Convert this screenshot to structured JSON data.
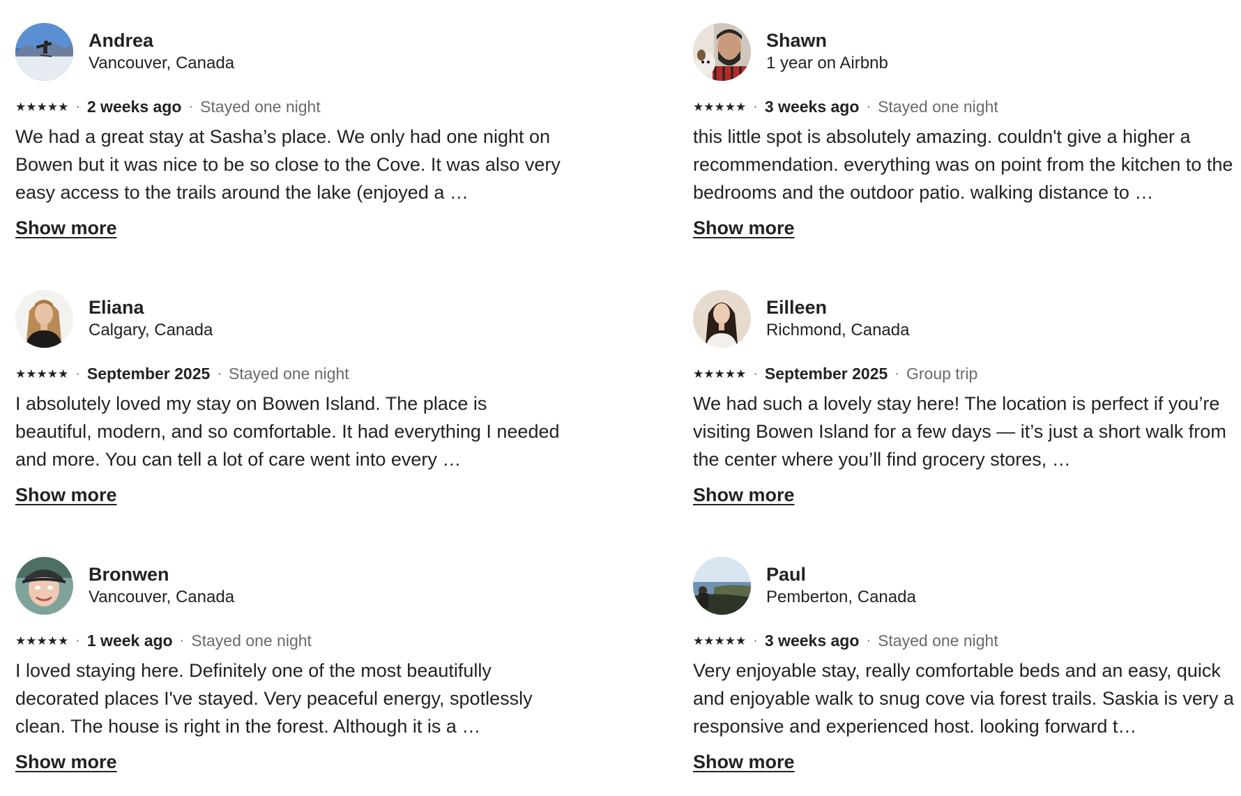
{
  "reviews": [
    {
      "name": "Andrea",
      "sub": "Vancouver, Canada",
      "rating_stars": 5,
      "stars": "★★★★★",
      "date": "2 weeks ago",
      "stay": "Stayed one night",
      "text": "We had a great stay at Sasha’s place. We only had one night on Bowen but it was nice to be so close to the Cove. It was also very easy access to the trails around the lake (enjoyed a …",
      "show_more": "Show more",
      "avatar": "avatar-snow-photo"
    },
    {
      "name": "Shawn",
      "sub": "1 year on Airbnb",
      "rating_stars": 5,
      "stars": "★★★★★",
      "date": "3 weeks ago",
      "stay": "Stayed one night",
      "text": "this little spot is absolutely amazing. couldn't give a higher a recommendation. everything was on point from the kitchen to the bedrooms and the outdoor patio. walking distance to …",
      "show_more": "Show more",
      "avatar": "avatar-man-with-dog"
    },
    {
      "name": "Eliana",
      "sub": "Calgary, Canada",
      "rating_stars": 5,
      "stars": "★★★★★",
      "date": "September 2025",
      "stay": "Stayed one night",
      "text": "I absolutely loved my stay on Bowen Island. The place is beautiful, modern, and so comfortable. It had everything I needed and more. You can tell a lot of care went into every …",
      "show_more": "Show more",
      "avatar": "avatar-woman-portrait"
    },
    {
      "name": "Eilleen",
      "sub": "Richmond, Canada",
      "rating_stars": 5,
      "stars": "★★★★★",
      "date": "September 2025",
      "stay": "Group trip",
      "text": "We had such a lovely stay here! The location is perfect if you’re visiting Bowen Island for a few days — it’s just a short walk from the center where you’ll find grocery stores, …",
      "show_more": "Show more",
      "avatar": "avatar-woman-dark-hair"
    },
    {
      "name": "Bronwen",
      "sub": "Vancouver, Canada",
      "rating_stars": 5,
      "stars": "★★★★★",
      "date": "1 week ago",
      "stay": "Stayed one night",
      "text": "I loved staying here. Definitely one of the most beautifully decorated places I've stayed. Very peaceful energy, spotlessly clean. The house is right in the forest. Although it is a …",
      "show_more": "Show more",
      "avatar": "avatar-woman-cap"
    },
    {
      "name": "Paul",
      "sub": "Pemberton, Canada",
      "rating_stars": 5,
      "stars": "★★★★★",
      "date": "3 weeks ago",
      "stay": "Stayed one night",
      "text": "Very enjoyable stay, really comfortable beds and an easy, quick and enjoyable walk to snug cove via forest trails. Saskia is very a responsive and experienced host. looking forward t…",
      "show_more": "Show more",
      "avatar": "avatar-coast-landscape"
    }
  ],
  "separator": "·",
  "colors": {
    "text": "#222222",
    "muted": "#6a6a6a",
    "background": "#ffffff"
  }
}
